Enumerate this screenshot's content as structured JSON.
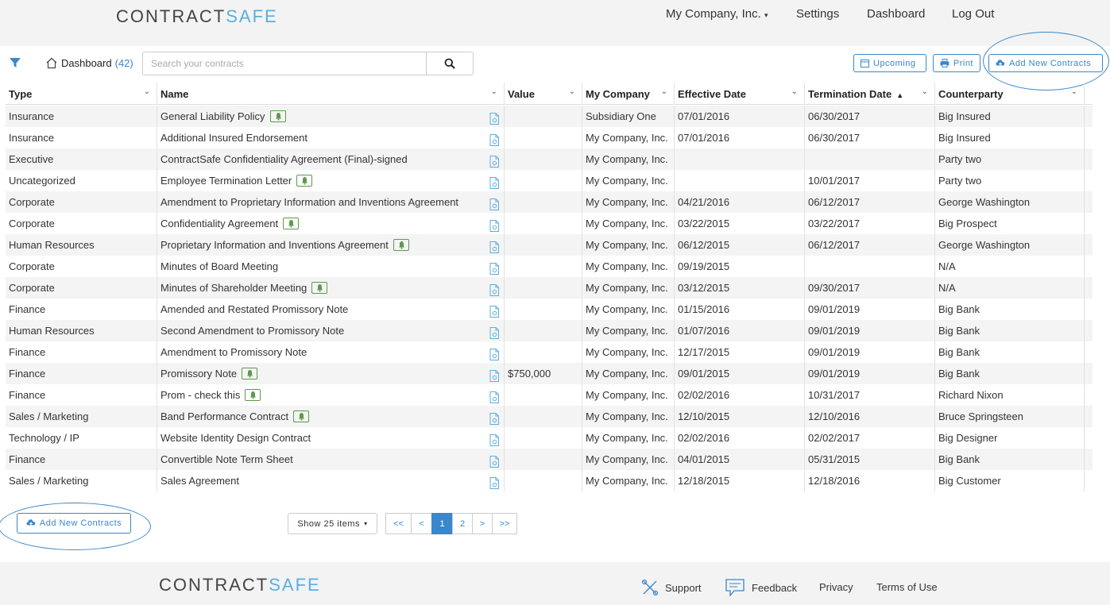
{
  "header": {
    "logo_part1": "CONTRACT",
    "logo_part2": "SAFE",
    "company_menu": "My Company, Inc.",
    "nav": [
      "Settings",
      "Dashboard",
      "Log Out"
    ]
  },
  "toolbar": {
    "home_label": "Dashboard",
    "home_count": "(42)",
    "search_placeholder": "Search your contracts",
    "upcoming_label": "Upcoming",
    "print_label": "Print",
    "add_label": "Add New Contracts"
  },
  "table": {
    "columns": [
      "Type",
      "Name",
      "Value",
      "My Company",
      "Effective Date",
      "Termination Date",
      "Counterparty"
    ],
    "rows": [
      {
        "type": "Insurance",
        "name": "General Liability Policy",
        "bell": true,
        "value": "",
        "company": "Subsidiary One",
        "effective": "07/01/2016",
        "termination": "06/30/2017",
        "counterparty": "Big Insured"
      },
      {
        "type": "Insurance",
        "name": "Additional Insured Endorsement",
        "bell": false,
        "value": "",
        "company": "My Company, Inc.",
        "effective": "07/01/2016",
        "termination": "06/30/2017",
        "counterparty": "Big Insured"
      },
      {
        "type": "Executive",
        "name": "ContractSafe Confidentiality Agreement (Final)-signed",
        "bell": false,
        "value": "",
        "company": "My Company, Inc.",
        "effective": "",
        "termination": "",
        "counterparty": "Party two"
      },
      {
        "type": "Uncategorized",
        "name": "Employee Termination Letter",
        "bell": true,
        "value": "",
        "company": "My Company, Inc.",
        "effective": "",
        "termination": "10/01/2017",
        "counterparty": "Party two"
      },
      {
        "type": "Corporate",
        "name": "Amendment to Proprietary Information and Inventions Agreement",
        "bell": false,
        "value": "",
        "company": "My Company, Inc.",
        "effective": "04/21/2016",
        "termination": "06/12/2017",
        "counterparty": "George Washington"
      },
      {
        "type": "Corporate",
        "name": "Confidentiality Agreement",
        "bell": true,
        "value": "",
        "company": "My Company, Inc.",
        "effective": "03/22/2015",
        "termination": "03/22/2017",
        "counterparty": "Big Prospect"
      },
      {
        "type": "Human Resources",
        "name": "Proprietary Information and Inventions Agreement",
        "bell": true,
        "value": "",
        "company": "My Company, Inc.",
        "effective": "06/12/2015",
        "termination": "06/12/2017",
        "counterparty": "George Washington"
      },
      {
        "type": "Corporate",
        "name": "Minutes of Board Meeting",
        "bell": false,
        "value": "",
        "company": "My Company, Inc.",
        "effective": "09/19/2015",
        "termination": "",
        "counterparty": "N/A"
      },
      {
        "type": "Corporate",
        "name": "Minutes of Shareholder Meeting",
        "bell": true,
        "value": "",
        "company": "My Company, Inc.",
        "effective": "03/12/2015",
        "termination": "09/30/2017",
        "counterparty": "N/A"
      },
      {
        "type": "Finance",
        "name": "Amended and Restated Promissory Note",
        "bell": false,
        "value": "",
        "company": "My Company, Inc.",
        "effective": "01/15/2016",
        "termination": "09/01/2019",
        "counterparty": "Big Bank"
      },
      {
        "type": "Human Resources",
        "name": "Second Amendment to Promissory Note",
        "bell": false,
        "value": "",
        "company": "My Company, Inc.",
        "effective": "01/07/2016",
        "termination": "09/01/2019",
        "counterparty": "Big Bank"
      },
      {
        "type": "Finance",
        "name": "Amendment to Promissory Note",
        "bell": false,
        "value": "",
        "company": "My Company, Inc.",
        "effective": "12/17/2015",
        "termination": "09/01/2019",
        "counterparty": "Big Bank"
      },
      {
        "type": "Finance",
        "name": "Promissory Note",
        "bell": true,
        "value": "$750,000",
        "company": "My Company, Inc.",
        "effective": "09/01/2015",
        "termination": "09/01/2019",
        "counterparty": "Big Bank"
      },
      {
        "type": "Finance",
        "name": "Prom - check this",
        "bell": true,
        "value": "",
        "company": "My Company, Inc.",
        "effective": "02/02/2016",
        "termination": "10/31/2017",
        "counterparty": "Richard Nixon"
      },
      {
        "type": "Sales / Marketing",
        "name": "Band Performance Contract",
        "bell": true,
        "value": "",
        "company": "My Company, Inc.",
        "effective": "12/10/2015",
        "termination": "12/10/2016",
        "counterparty": "Bruce Springsteen"
      },
      {
        "type": "Technology / IP",
        "name": "Website Identity Design Contract",
        "bell": false,
        "value": "",
        "company": "My Company, Inc.",
        "effective": "02/02/2016",
        "termination": "02/02/2017",
        "counterparty": "Big Designer"
      },
      {
        "type": "Finance",
        "name": "Convertible Note Term Sheet",
        "bell": false,
        "value": "",
        "company": "My Company, Inc.",
        "effective": "04/01/2015",
        "termination": "05/31/2015",
        "counterparty": "Big Bank"
      },
      {
        "type": "Sales / Marketing",
        "name": "Sales Agreement",
        "bell": false,
        "value": "",
        "company": "My Company, Inc.",
        "effective": "12/18/2015",
        "termination": "12/18/2016",
        "counterparty": "Big Customer"
      }
    ]
  },
  "bottom": {
    "add_label": "Add New Contracts",
    "show_items_label": "Show 25 items",
    "pager": [
      "<<",
      "<",
      "1",
      "2",
      ">",
      ">>"
    ],
    "active_page": "1"
  },
  "footer": {
    "logo_part1": "CONTRACT",
    "logo_part2": "SAFE",
    "links": [
      "Support",
      "Feedback",
      "Privacy",
      "Terms of Use"
    ]
  },
  "colors": {
    "accent": "#3a87c9",
    "logo_accent": "#5aaee0",
    "bell_green": "#5a9b4a",
    "header_bg": "#f3f3f3"
  }
}
